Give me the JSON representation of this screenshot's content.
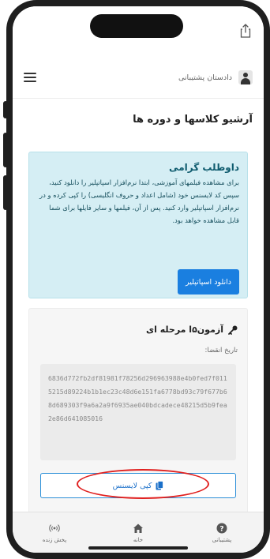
{
  "header": {
    "user_name": "دادستان پشتیبانی"
  },
  "page": {
    "title": "آرشیو کلاسها و دوره ها"
  },
  "notice": {
    "title": "داوطلب گرامی",
    "body": "برای مشاهده فیلمهای آموزشی، ابتدا نرم‌افزار اسپاتپلیر را دانلود کنید، سپس کد لایسنس خود (شامل اعداد و حروف انگلیسی) را کپی کرده و در نرم‌افزار اسپاتپلیر وارد کنید. پس از آن، فیلمها و سایر فایلها برای شما قابل مشاهده خواهد بود.",
    "download_button": "دانلود اسپاتپلیر"
  },
  "exam": {
    "title": "آزمون۵ا مرحله ای",
    "expire_label": "تاریخ انقضا:",
    "license_key": "6836d772fb2df81981f78256d296963988e4b0fed7f0115215d89224b1b1ec23c48d6e151fa6778bd93c79f677b68d689303f9a6a2a9f6935ae040bdcadece48215d5b9fea2e86d641085016",
    "copy_button": "کپی لایسنس"
  },
  "bottom_nav": {
    "items": [
      {
        "label": "پشتیبانی",
        "icon": "help-circle-icon"
      },
      {
        "label": "خانه",
        "icon": "home-icon"
      },
      {
        "label": "پخش زنده",
        "icon": "live-broadcast-icon"
      }
    ]
  },
  "colors": {
    "primary": "#1a7fe0",
    "notice_bg": "#d5eef4",
    "highlight": "#e0201f"
  }
}
